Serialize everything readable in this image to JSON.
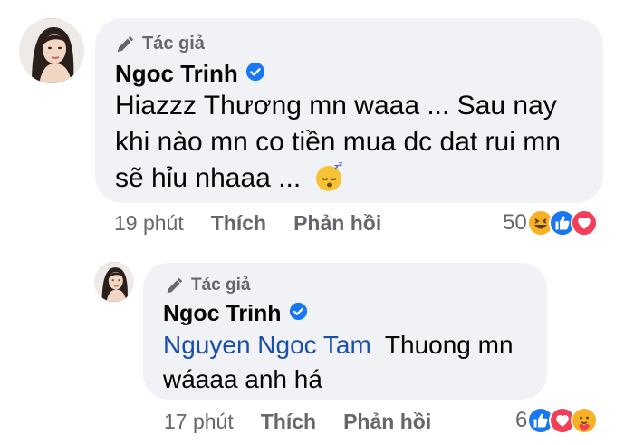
{
  "main_comment": {
    "badge": "Tác giả",
    "author": "Ngoc Trinh",
    "text": "Hiazzz Thương mn waaa ... Sau nay khi nào mn co tiền mua dc dat rui mn sẽ hỉu nhaaa ...",
    "emoji": "sleeping-face-icon",
    "time": "19 phút",
    "like_label": "Thích",
    "reply_label": "Phản hồi",
    "reaction_count": "50",
    "reactions": [
      "haha-icon",
      "like-icon",
      "love-icon"
    ]
  },
  "reply_comment": {
    "badge": "Tác giả",
    "author": "Ngoc Trinh",
    "mention": "Nguyen Ngoc Tam",
    "text": "Thuong mn wáaaa anh há",
    "time": "17 phút",
    "like_label": "Thích",
    "reply_label": "Phản hồi",
    "reaction_count": "6",
    "reactions": [
      "like-icon",
      "love-icon",
      "care-icon"
    ]
  },
  "colors": {
    "bubble": "#f0f2f5",
    "mention": "#1b4fa8",
    "verified": "#1877f2",
    "meta_text": "#65676b",
    "like": "#1877f2",
    "love": "#f33e58",
    "haha": "#f7b125"
  }
}
